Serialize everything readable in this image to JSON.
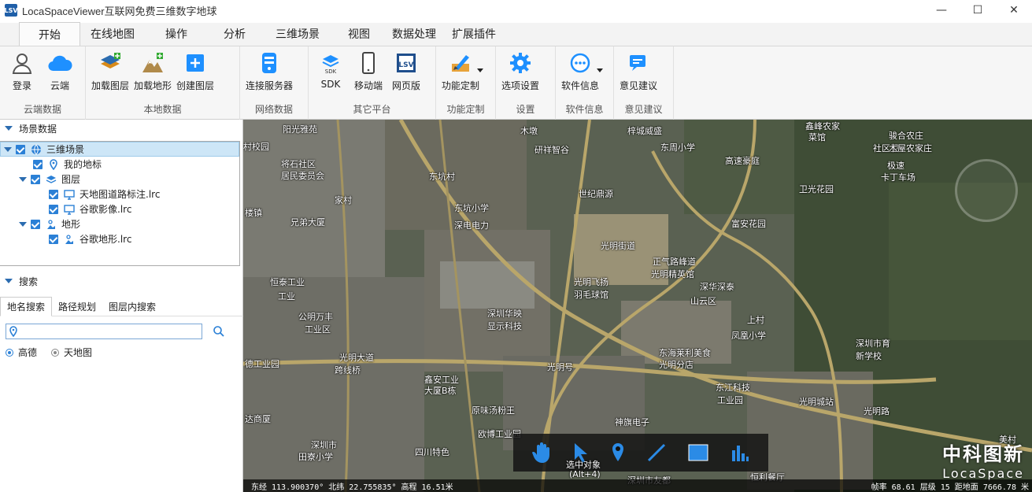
{
  "window": {
    "title": "LocaSpaceViewer互联网免费三维数字地球",
    "app_icon": "LSV",
    "minimize": "—",
    "maximize": "☐",
    "close": "✕"
  },
  "tabs": [
    "开始",
    "在线地图",
    "操作",
    "分析",
    "三维场景",
    "视图",
    "数据处理",
    "扩展插件"
  ],
  "ribbon": {
    "groups": [
      {
        "label": "云端数据",
        "buttons": [
          {
            "label": "登录",
            "icon": "user-icon"
          },
          {
            "label": "云端",
            "icon": "cloud-icon"
          }
        ]
      },
      {
        "label": "本地数据",
        "buttons": [
          {
            "label": "加载图层",
            "icon": "load-layer-icon"
          },
          {
            "label": "加载地形",
            "icon": "load-terrain-icon"
          },
          {
            "label": "创建图层",
            "icon": "create-layer-icon"
          }
        ]
      },
      {
        "label": "网络数据",
        "buttons": [
          {
            "label": "连接服务器",
            "icon": "server-icon"
          }
        ]
      },
      {
        "label": "其它平台",
        "buttons": [
          {
            "label": "SDK",
            "icon": "sdk-icon"
          },
          {
            "label": "移动端",
            "icon": "mobile-icon"
          },
          {
            "label": "网页版",
            "icon": "web-icon"
          }
        ]
      },
      {
        "label": "功能定制",
        "buttons": [
          {
            "label": "功能定制",
            "icon": "customize-icon"
          }
        ]
      },
      {
        "label": "设置",
        "buttons": [
          {
            "label": "选项设置",
            "icon": "gear-icon"
          }
        ]
      },
      {
        "label": "软件信息",
        "buttons": [
          {
            "label": "软件信息",
            "icon": "info-icon"
          }
        ]
      },
      {
        "label": "意见建议",
        "buttons": [
          {
            "label": "意见建议",
            "icon": "feedback-icon"
          }
        ]
      }
    ]
  },
  "scene": {
    "header": "场景数据",
    "tree": [
      {
        "label": "三维场景",
        "level": 0,
        "expand": true,
        "icon": "globe-icon",
        "selected": true
      },
      {
        "label": "我的地标",
        "level": 1,
        "expand": false,
        "icon": "placemark-icon",
        "selected": false
      },
      {
        "label": "图层",
        "level": 1,
        "expand": true,
        "icon": "layers-icon",
        "selected": false
      },
      {
        "label": "天地图道路标注.lrc",
        "level": 2,
        "expand": false,
        "icon": "monitor-icon",
        "selected": false
      },
      {
        "label": "谷歌影像.lrc",
        "level": 2,
        "expand": false,
        "icon": "monitor-icon",
        "selected": false
      },
      {
        "label": "地形",
        "level": 1,
        "expand": true,
        "icon": "terrain-icon",
        "selected": false
      },
      {
        "label": "谷歌地形.lrc",
        "level": 2,
        "expand": false,
        "icon": "terrain-icon",
        "selected": false
      }
    ]
  },
  "search": {
    "header": "搜索",
    "tabs": [
      "地名搜索",
      "路径规划",
      "图层内搜索"
    ],
    "input_value": "",
    "radio_options": [
      "高德",
      "天地图"
    ],
    "selected": "高德"
  },
  "map": {
    "labels": [
      {
        "text": "阳光雅苑"
      },
      {
        "text": "木墩"
      },
      {
        "text": "梓城威盛"
      },
      {
        "text": "鑫峰农家"
      },
      {
        "text": "骏合农庄"
      },
      {
        "text": "菜馆"
      },
      {
        "text": "社区卫"
      },
      {
        "text": "研祥智谷"
      },
      {
        "text": "东周小学"
      },
      {
        "text": "木屋农家庄"
      },
      {
        "text": "将石社区"
      },
      {
        "text": "居民委员会"
      },
      {
        "text": "高速豪庭"
      },
      {
        "text": "极速"
      },
      {
        "text": "卡丁车场"
      },
      {
        "text": "东坑村"
      },
      {
        "text": "世纪鼎源"
      },
      {
        "text": "卫光花园"
      },
      {
        "text": "家村"
      },
      {
        "text": "东坑小学"
      },
      {
        "text": "深电电力"
      },
      {
        "text": "富安花园"
      },
      {
        "text": "光明街道"
      },
      {
        "text": "正气路峰道"
      },
      {
        "text": "光明精英馆"
      },
      {
        "text": "光明飞扬"
      },
      {
        "text": "羽毛球馆"
      },
      {
        "text": "深华深泰"
      },
      {
        "text": "山云区"
      },
      {
        "text": "恒泰工业"
      },
      {
        "text": "深圳华映"
      },
      {
        "text": "显示科技"
      },
      {
        "text": "公明万丰"
      },
      {
        "text": "工业区"
      },
      {
        "text": "上村"
      },
      {
        "text": "凤凰小学"
      },
      {
        "text": "深圳市育"
      },
      {
        "text": "新学校"
      },
      {
        "text": "东海莱利美食"
      },
      {
        "text": "光明分店"
      },
      {
        "text": "德工业园"
      },
      {
        "text": "光明大道"
      },
      {
        "text": "跨线桥"
      },
      {
        "text": "光明号"
      },
      {
        "text": "东江科技"
      },
      {
        "text": "工业园"
      },
      {
        "text": "光明城站"
      },
      {
        "text": "鑫安工业"
      },
      {
        "text": "大厦B栋"
      },
      {
        "text": "原味汤粉王"
      },
      {
        "text": "达商厦"
      },
      {
        "text": "欧博工业园"
      },
      {
        "text": "神旗电子"
      },
      {
        "text": "深圳市"
      },
      {
        "text": "田寮小学"
      },
      {
        "text": "四川特色"
      },
      {
        "text": "深圳市友都"
      },
      {
        "text": "恒利餐厅"
      },
      {
        "text": "光明路"
      },
      {
        "text": "兄弟大厦"
      },
      {
        "text": "工业"
      },
      {
        "text": "村校园"
      },
      {
        "text": "楼镇"
      },
      {
        "text": "美村"
      }
    ],
    "toolbar_tooltip_line1": "选中对象",
    "toolbar_tooltip_line2": "(Alt+4)",
    "brand_cn": "中科图新",
    "brand_en": "LocaSpace",
    "status_left": "东经 113.900370° 北纬 22.755835° 高程 16.51米",
    "status_right": "帧率 68.61  层级 15  距地面 7666.78 米"
  }
}
